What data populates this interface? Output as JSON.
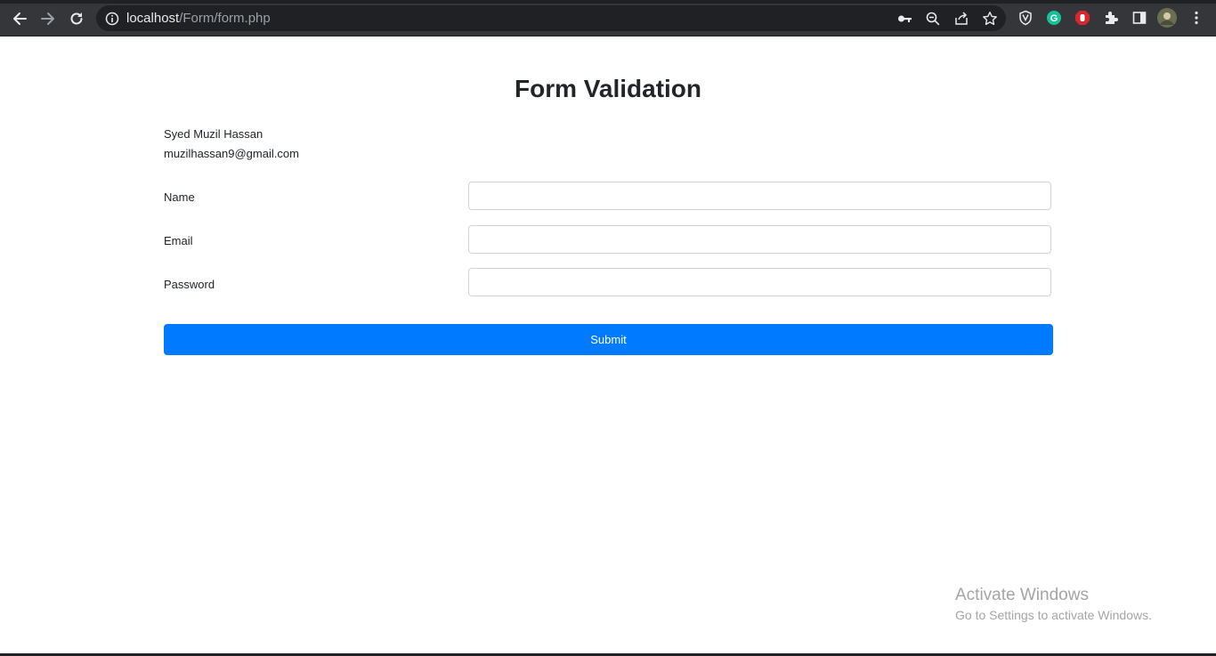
{
  "browser": {
    "url_host": "localhost",
    "url_path": "/Form/form.php",
    "icons": [
      "back-arrow-icon",
      "forward-arrow-icon",
      "reload-icon",
      "site-info-icon",
      "key-icon",
      "zoom-icon",
      "share-icon",
      "star-icon",
      "shield-icon",
      "grammarly-icon",
      "adblock-icon",
      "puzzle-icon",
      "sidepanel-icon",
      "profile-avatar",
      "more-icon"
    ]
  },
  "page": {
    "title": "Form Validation",
    "author_name": "Syed Muzil Hassan",
    "author_email": "muzilhassan9@gmail.com"
  },
  "form": {
    "name_label": "Name",
    "email_label": "Email",
    "password_label": "Password",
    "name_value": "",
    "email_value": "",
    "password_value": "",
    "submit_label": "Submit"
  },
  "watermark": {
    "line1": "Activate Windows",
    "line2": "Go to Settings to activate Windows."
  },
  "colors": {
    "accent": "#007bff",
    "chrome_bg": "#35363a",
    "omnibox_bg": "#202124"
  }
}
